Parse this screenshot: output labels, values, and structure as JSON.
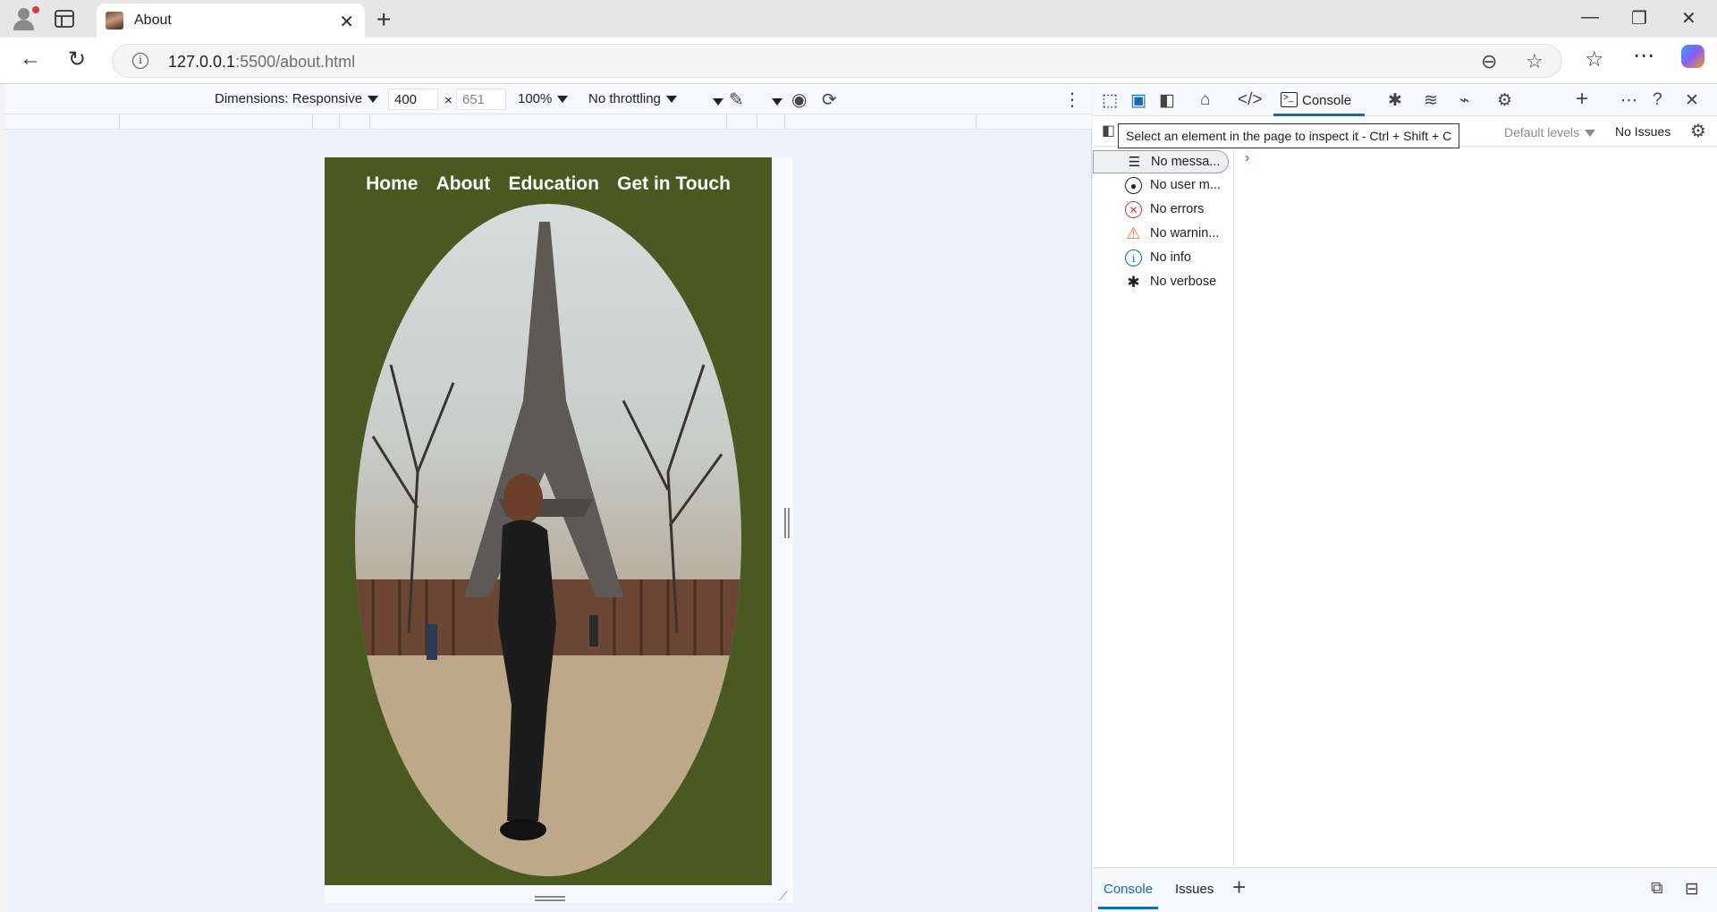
{
  "browser": {
    "tab_title": "About",
    "url_host": "127.0.0.1",
    "url_rest": ":5500/about.html"
  },
  "device_toolbar": {
    "dimensions_label": "Dimensions: Responsive",
    "width": "400",
    "height": "651",
    "times": "×",
    "zoom": "100%",
    "throttling": "No throttling"
  },
  "page": {
    "nav": [
      "Home",
      "About",
      "Education",
      "Get in Touch"
    ],
    "background_color": "#485a20"
  },
  "devtools": {
    "active_tab": "Console",
    "tooltip": "Select an element in the page to inspect it - Ctrl + Shift + C",
    "levels": "Default levels",
    "issues": "No Issues",
    "sidebar": [
      {
        "icon": "list-icon",
        "label": "No messa..."
      },
      {
        "icon": "user-icon",
        "label": "No user m..."
      },
      {
        "icon": "error-icon",
        "label": "No errors"
      },
      {
        "icon": "warning-icon",
        "label": "No warnin..."
      },
      {
        "icon": "info-icon",
        "label": "No info"
      },
      {
        "icon": "bug-icon",
        "label": "No verbose"
      }
    ],
    "drawer_tabs": [
      "Console",
      "Issues"
    ],
    "accent_color": "#0f6cbd"
  }
}
